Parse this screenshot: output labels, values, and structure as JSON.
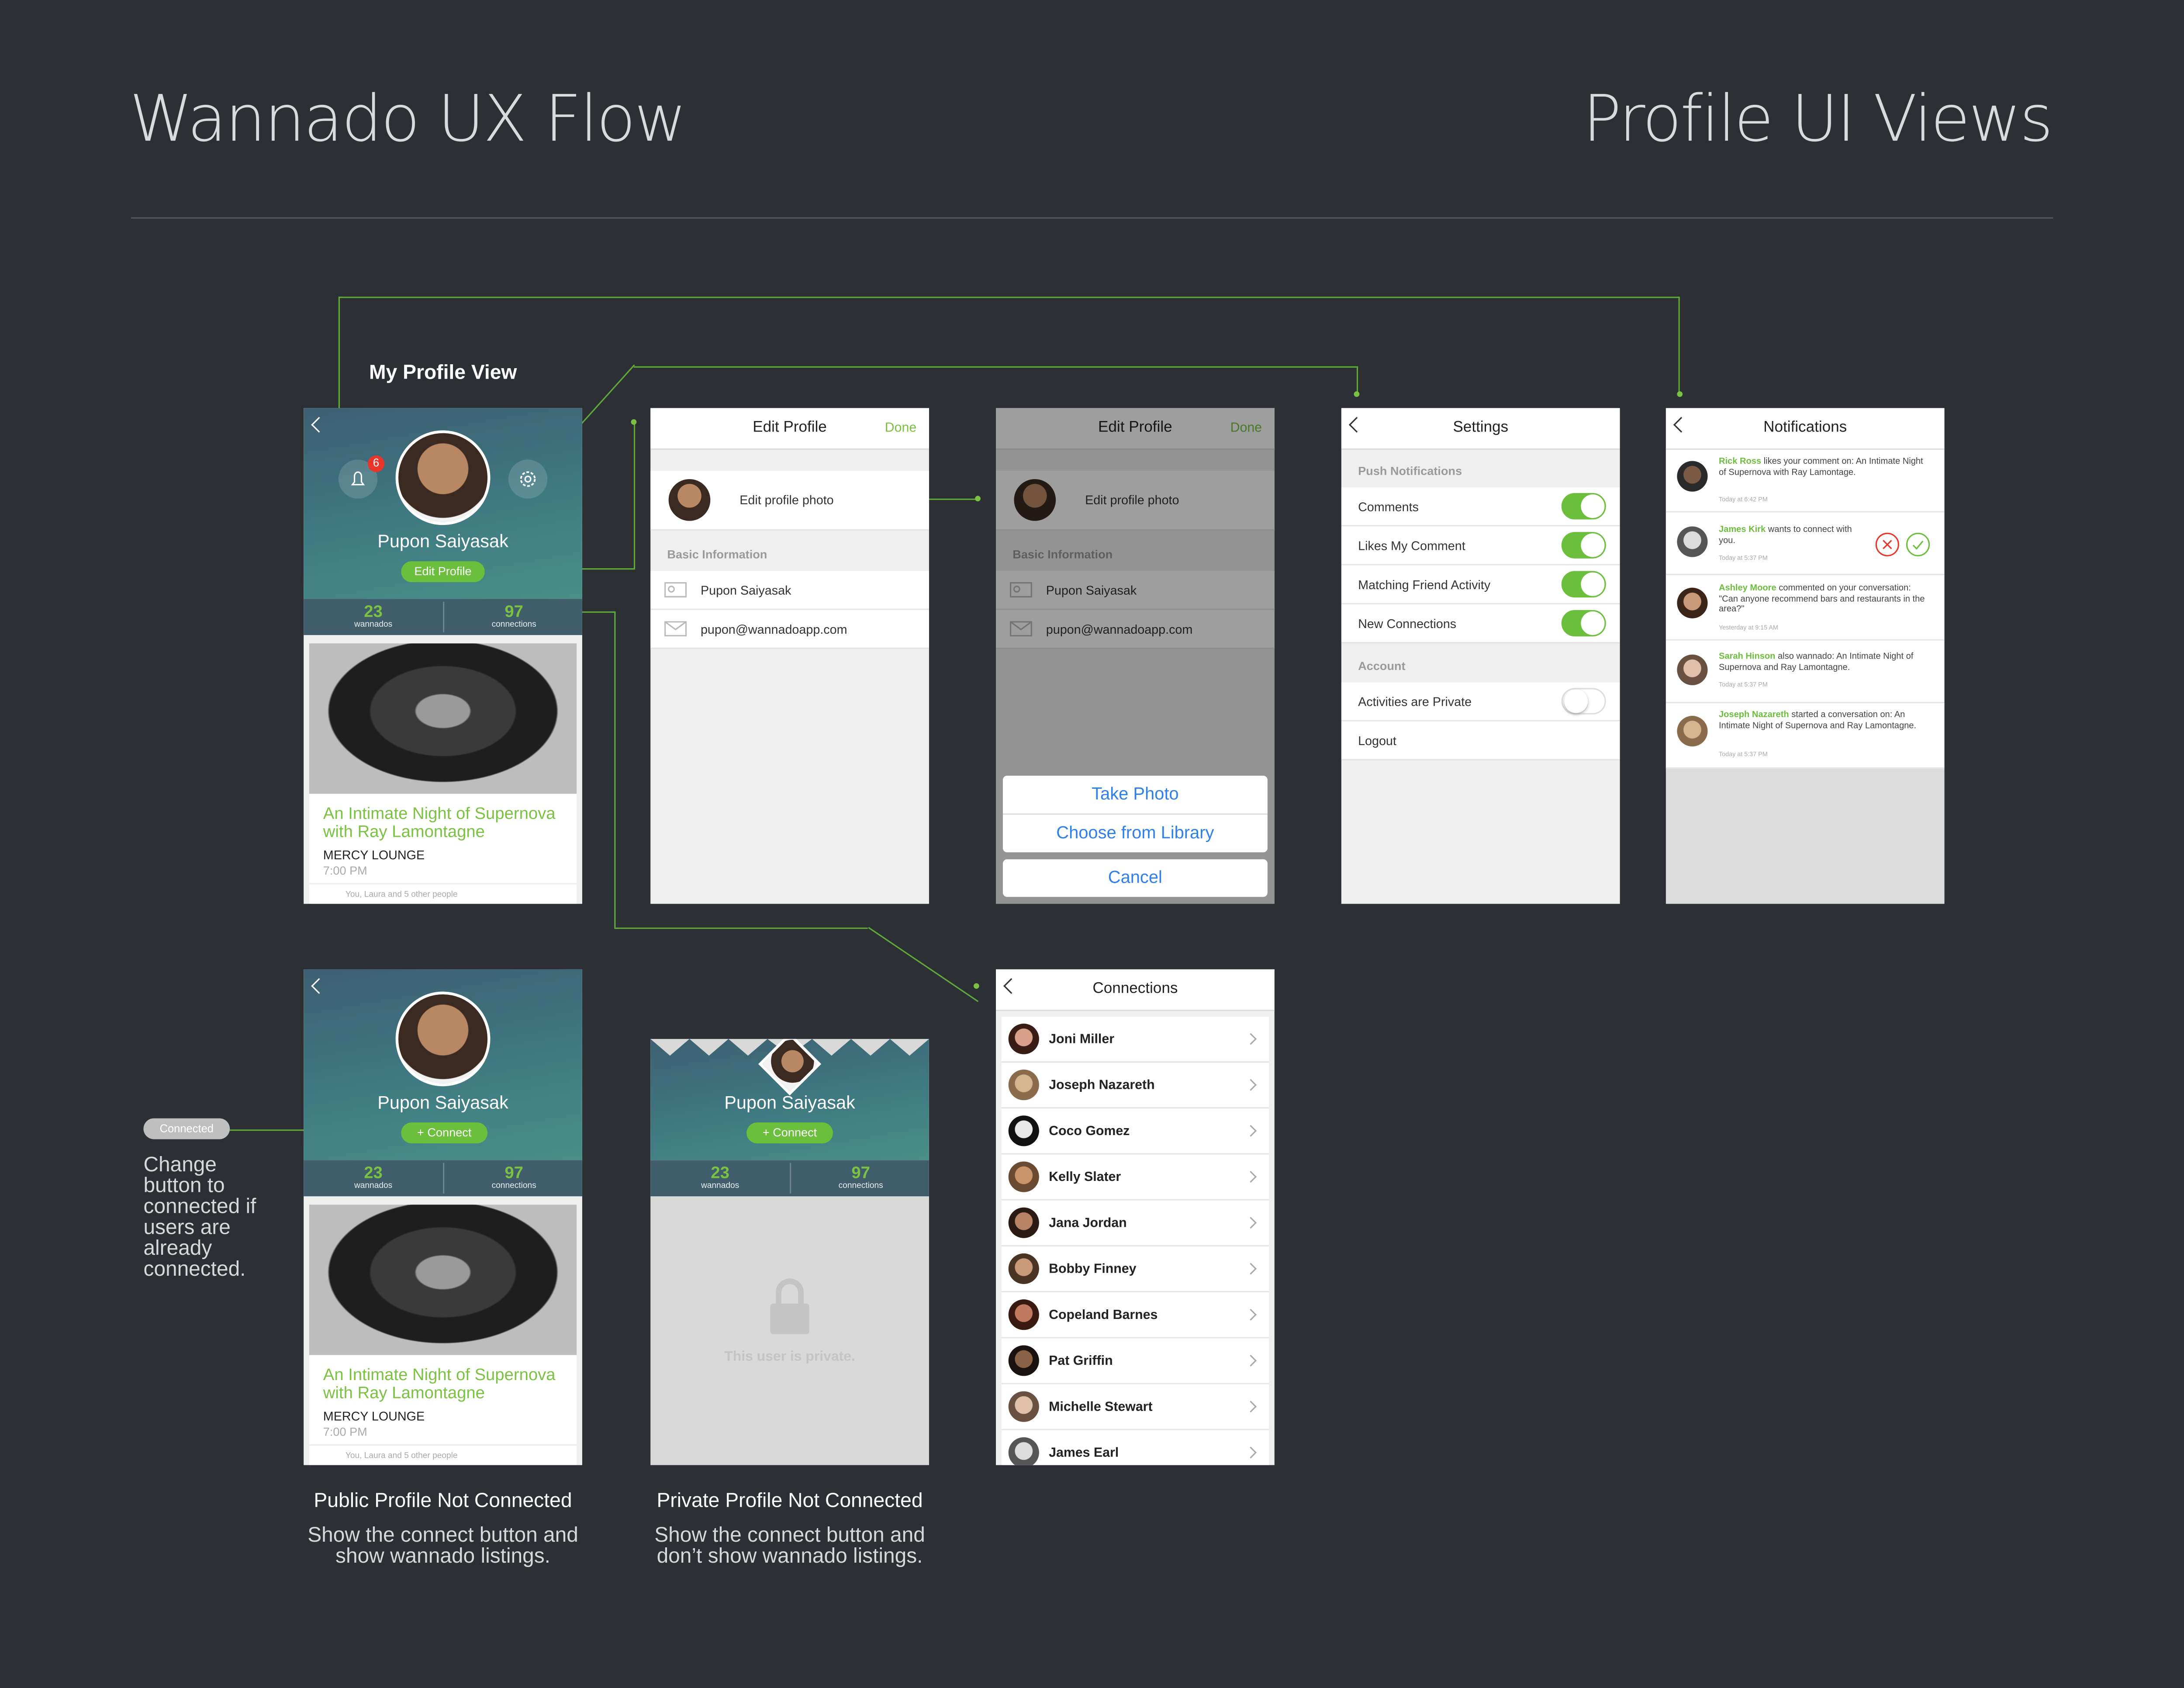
{
  "header": {
    "title_left": "Wannado UX Flow",
    "title_right": "Profile UI Views"
  },
  "my_profile": {
    "section_label": "My Profile View",
    "notification_count": "6",
    "name": "Pupon Saiyasak",
    "edit_button": "Edit Profile",
    "stats": {
      "wannados_n": "23",
      "wannados_l": "wannados",
      "connections_n": "97",
      "connections_l": "connections"
    },
    "card": {
      "title": "An Intimate Night of Supernova with Ray Lamontagne",
      "venue": "MERCY LOUNGE",
      "time": "7:00 PM",
      "friends": "You, Laura and 5 other people"
    }
  },
  "edit_profile": {
    "title": "Edit Profile",
    "done": "Done",
    "photo_label": "Edit profile photo",
    "section": "Basic Information",
    "name": "Pupon Saiyasak",
    "email": "pupon@wannadoapp.com"
  },
  "action_sheet": {
    "take_photo": "Take Photo",
    "choose_library": "Choose from Library",
    "cancel": "Cancel"
  },
  "settings": {
    "title": "Settings",
    "push_section": "Push Notifications",
    "push_items": [
      "Comments",
      "Likes My Comment",
      "Matching Friend Activity",
      "New Connections"
    ],
    "account_section": "Account",
    "private_label": "Activities are Private",
    "logout": "Logout"
  },
  "notifications": {
    "title": "Notifications",
    "items": [
      {
        "name": "Rick Ross",
        "text": " likes your comment on: An Intimate Night of Supernova with Ray Lamontage.",
        "time": "Today at 6:42 PM"
      },
      {
        "name": "James Kirk",
        "text": " wants to connect with you.",
        "time": "Today at 5:37 PM"
      },
      {
        "name": "Ashley Moore",
        "text": " commented on your conversation: \"Can anyone recommend bars and restaurants in the area?\"",
        "time": "Yesterday at 9:15 AM"
      },
      {
        "name": "Sarah Hinson",
        "text": " also wannado: An Intimate Night of Supernova and Ray Lamontagne.",
        "time": "Today at 5:37 PM"
      },
      {
        "name": "Joseph Nazareth",
        "text": " started a conversation on: An Intimate Night of Supernova and Ray Lamontagne.",
        "time": "Today at 5:37 PM"
      }
    ]
  },
  "public_profile": {
    "name": "Pupon Saiyasak",
    "connect": "+ Connect",
    "connected_badge": "Connected",
    "annotation": "Change button to connected if users are already connected.",
    "caption_title": "Public Profile Not Connected",
    "caption_desc": "Show the connect button and show wannado listings."
  },
  "private_profile": {
    "name": "Pupon Saiyasak",
    "connect": "+ Connect",
    "private_msg": "This user is private.",
    "caption_title": "Private Profile Not Connected",
    "caption_desc": "Show the connect button and don’t show wannado listings."
  },
  "connections": {
    "title": "Connections",
    "names": [
      "Joni Miller",
      "Joseph Nazareth",
      "Coco Gomez",
      "Kelly Slater",
      "Jana Jordan",
      "Bobby Finney",
      "Copeland Barnes",
      "Pat Griffin",
      "Michelle Stewart",
      "James Earl"
    ]
  },
  "colors": {
    "background": "#2c2f33",
    "accent_green": "#6cbf3c",
    "ios_blue": "#2f80ed",
    "flow_line": "#5fa83a"
  },
  "icons": [
    "back-chevron-icon",
    "bell-icon",
    "gear-icon",
    "lock-icon",
    "name-card-icon",
    "envelope-icon",
    "reject-x-icon",
    "accept-check-icon",
    "row-chevron-icon"
  ]
}
